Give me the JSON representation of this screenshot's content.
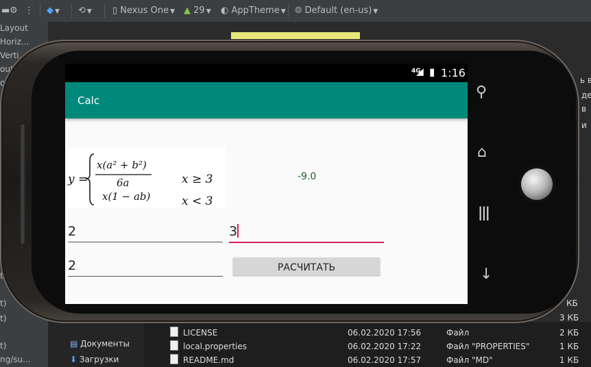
{
  "toolbar": {
    "device": "Nexus One",
    "api_level": "29",
    "theme": "AppTheme",
    "locale": "Default (en-us)"
  },
  "palette": {
    "items": [
      "Layout",
      "Horiz...",
      "Verti...",
      "out (",
      "out (",
      "ut",
      "ut",
      "",
      "",
      "",
      "tr)",
      "t)",
      "t)",
      "",
      "t)",
      "ng/su..."
    ]
  },
  "explorer": {
    "sidebar": [
      {
        "label": "Документы"
      },
      {
        "label": "Загрузки"
      }
    ],
    "files": [
      {
        "name": "LICENSE",
        "date": "06.02.2020 17:56",
        "type": "Файл",
        "size": "2 КБ"
      },
      {
        "name": "local.properties",
        "date": "06.02.2020 17:22",
        "type": "Файл \"PROPERTIES\"",
        "size": "1 КБ"
      },
      {
        "name": "README.md",
        "date": "06.02.2020 17:57",
        "type": "Файл \"MD\"",
        "size": "1 КБ"
      }
    ],
    "right_sizes": [
      "КБ",
      "3 КБ"
    ],
    "right_fragments": [
      "ь во",
      "де",
      "в",
      "и"
    ]
  },
  "device": {
    "status": {
      "network": "4G",
      "time": "1:16"
    },
    "app": {
      "title": "Calc",
      "result": "-9.0",
      "input_a": "2",
      "input_b": "3",
      "input_x": "2",
      "button": "РАСЧИТАТЬ"
    }
  },
  "formula": {
    "y": "y =",
    "top": "x(a² + b²)",
    "denom": "6a",
    "bottom": "x(1 − ab)",
    "cond1": "x ≥ 3",
    "cond2": "x < 3"
  },
  "colors": {
    "app_bar": "#00897b",
    "accent": "#d81b60",
    "result": "#1b5e20"
  }
}
